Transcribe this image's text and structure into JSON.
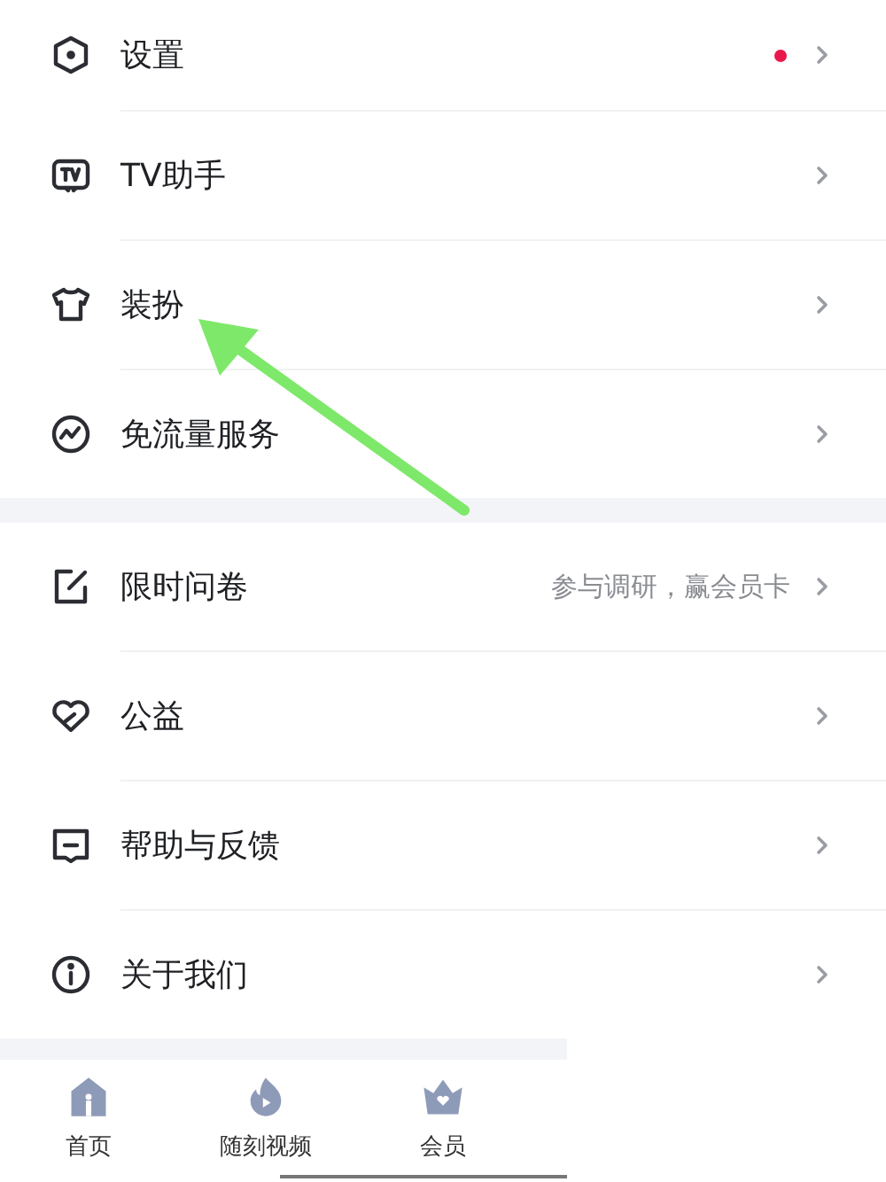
{
  "sections": [
    {
      "items": [
        {
          "kind": "settings",
          "label": "设置",
          "dot": true
        },
        {
          "kind": "tv",
          "label": "TV助手",
          "dot": false
        },
        {
          "kind": "shirt",
          "label": "装扮",
          "dot": false
        },
        {
          "kind": "traffic",
          "label": "免流量服务",
          "dot": false
        }
      ]
    },
    {
      "items": [
        {
          "kind": "survey",
          "label": "限时问卷",
          "hint": "参与调研，赢会员卡",
          "dot": false
        },
        {
          "kind": "charity",
          "label": "公益",
          "dot": false
        },
        {
          "kind": "feedback",
          "label": "帮助与反馈",
          "dot": false
        },
        {
          "kind": "about",
          "label": "关于我们",
          "dot": false
        }
      ]
    }
  ],
  "nav": [
    {
      "kind": "home",
      "label": "首页",
      "selected": false
    },
    {
      "kind": "video",
      "label": "随刻视频",
      "selected": false
    },
    {
      "kind": "vip",
      "label": "会员",
      "selected": false
    }
  ]
}
